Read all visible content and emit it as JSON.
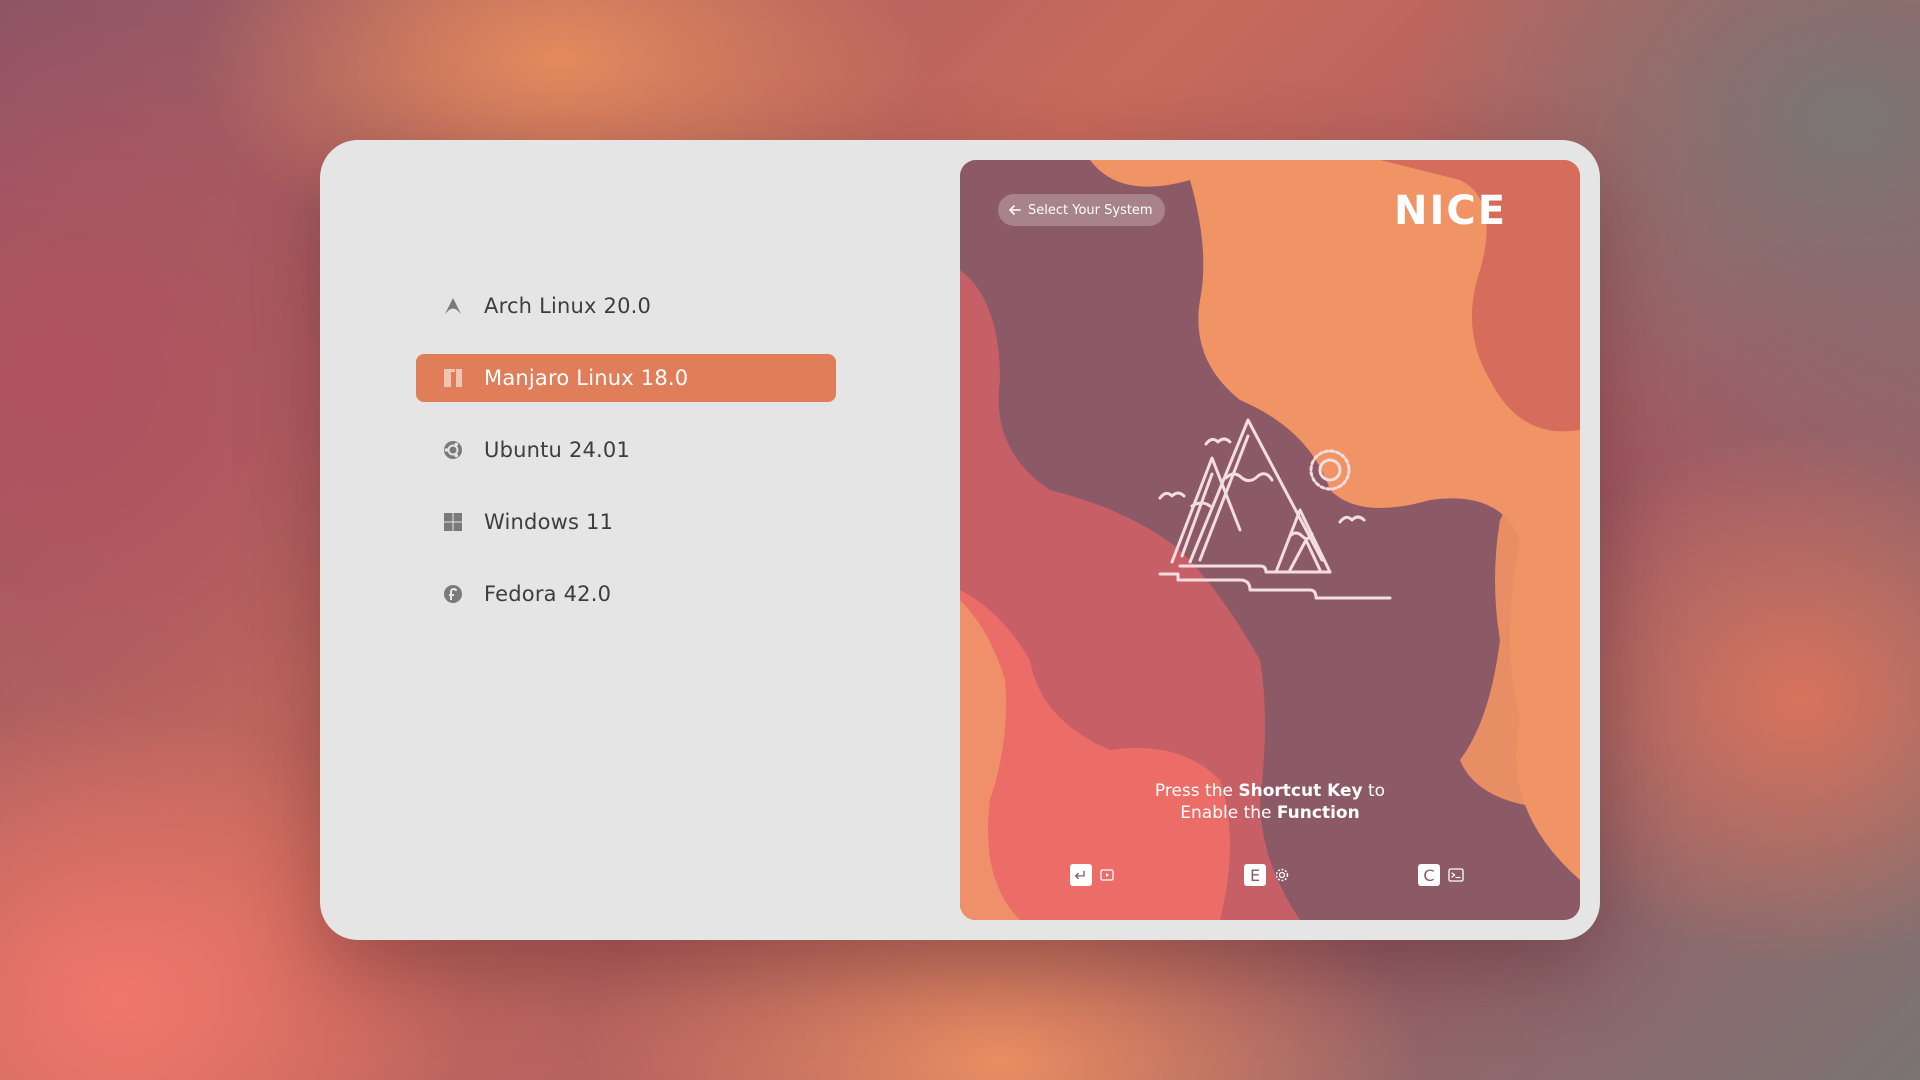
{
  "systems": [
    {
      "label": "Arch Linux 20.0",
      "icon": "arch-linux-icon",
      "selected": false
    },
    {
      "label": "Manjaro Linux 18.0",
      "icon": "manjaro-icon",
      "selected": true
    },
    {
      "label": "Ubuntu 24.01",
      "icon": "ubuntu-icon",
      "selected": false
    },
    {
      "label": "Windows 11",
      "icon": "windows-icon",
      "selected": false
    },
    {
      "label": "Fedora 42.0",
      "icon": "fedora-icon",
      "selected": false
    }
  ],
  "panel": {
    "back_label": "Select Your System",
    "logo_text": "NICE",
    "hint": {
      "part1": "Press the ",
      "bold1": "Shortcut Key",
      "part2": " to",
      "part3": "Enable the ",
      "bold2": "Function"
    },
    "shortcuts": [
      {
        "key": "↵",
        "icon": "boot-icon"
      },
      {
        "key": "E",
        "icon": "settings-icon"
      },
      {
        "key": "C",
        "icon": "terminal-icon"
      }
    ]
  },
  "colors": {
    "accent": "#e07e5a",
    "window_bg": "#e5e5e5",
    "text": "#3d3d3d"
  }
}
